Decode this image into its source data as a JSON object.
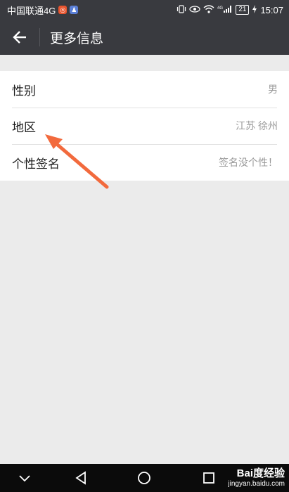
{
  "status_bar": {
    "carrier": "中国联通4G",
    "time": "15:07",
    "battery": "21",
    "network_tag": "4G",
    "left_icons": [
      "weibo-icon",
      "qq-icon"
    ],
    "right_icons": [
      "vibrate-icon",
      "eye-icon",
      "wifi-icon",
      "signal-icon",
      "battery-icon",
      "charging-icon"
    ]
  },
  "app_bar": {
    "title": "更多信息",
    "back_icon": "back-arrow-icon"
  },
  "rows": [
    {
      "label": "性别",
      "value": "男"
    },
    {
      "label": "地区",
      "value": "江苏 徐州"
    },
    {
      "label": "个性签名",
      "value": "签名没个性！"
    }
  ],
  "annotation": {
    "color": "#f26a3d"
  },
  "nav_bar": {
    "icons": [
      "chevron-down-icon",
      "back-triangle-icon",
      "home-circle-icon",
      "recents-square-icon"
    ]
  },
  "watermark": {
    "brand": "Bai度经验",
    "url": "jingyan.baidu.com"
  },
  "colors": {
    "header_bg": "#393a3f",
    "page_bg": "#ebebeb",
    "nav_bg": "#0b0b0b"
  }
}
